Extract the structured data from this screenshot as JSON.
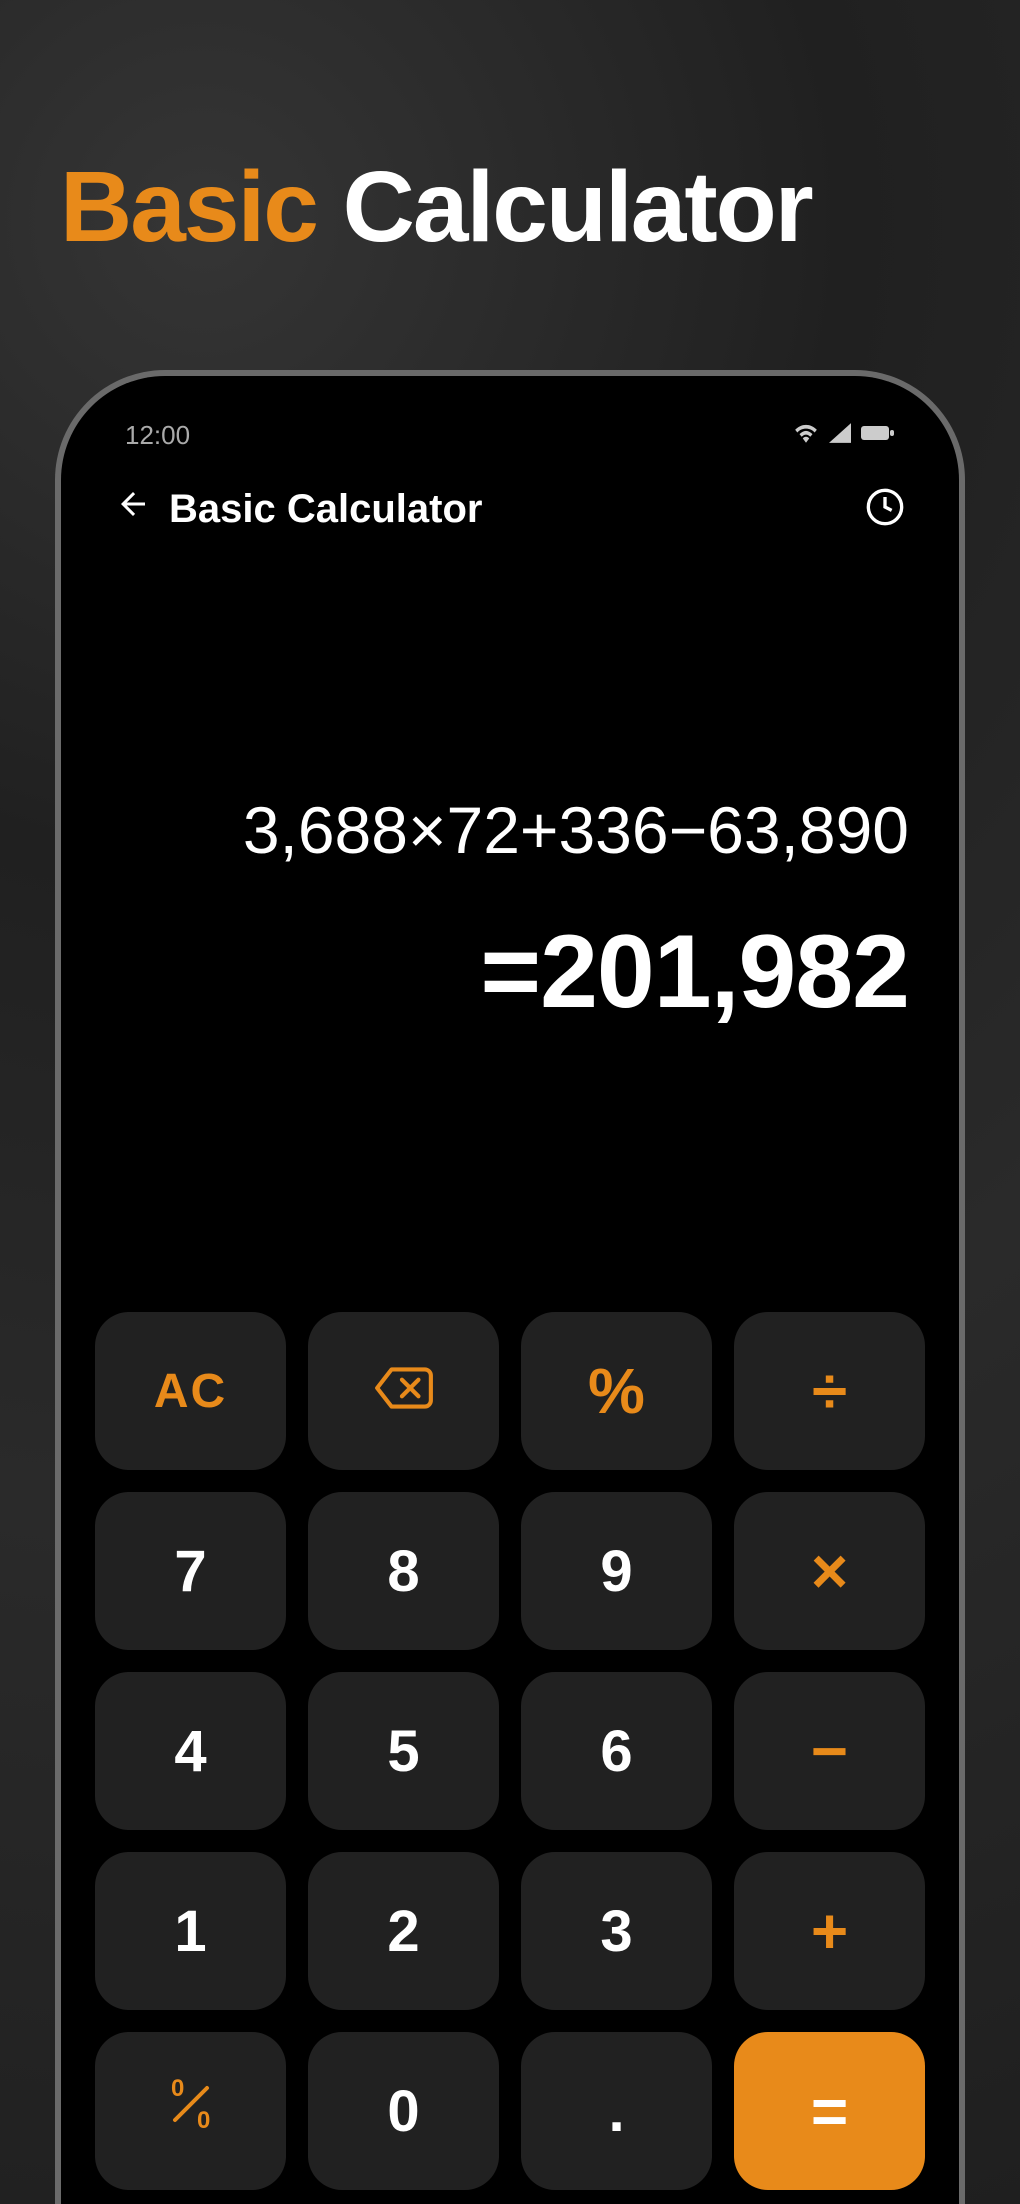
{
  "promo": {
    "accent_word": "Basic",
    "rest": "Calculator"
  },
  "status": {
    "time": "12:00"
  },
  "header": {
    "title": "Basic Calculator"
  },
  "calc": {
    "expression": "3,688×72+336−63,890",
    "result": "=201,982"
  },
  "keys": {
    "ac": "AC",
    "backspace": "⌫",
    "percent": "%",
    "divide": "÷",
    "k7": "7",
    "k8": "8",
    "k9": "9",
    "multiply": "×",
    "k4": "4",
    "k5": "5",
    "k6": "6",
    "minus": "−",
    "k1": "1",
    "k2": "2",
    "k3": "3",
    "plus": "+",
    "fraction": "⁰⁄₀",
    "k0": "0",
    "dot": ".",
    "equals": "="
  }
}
